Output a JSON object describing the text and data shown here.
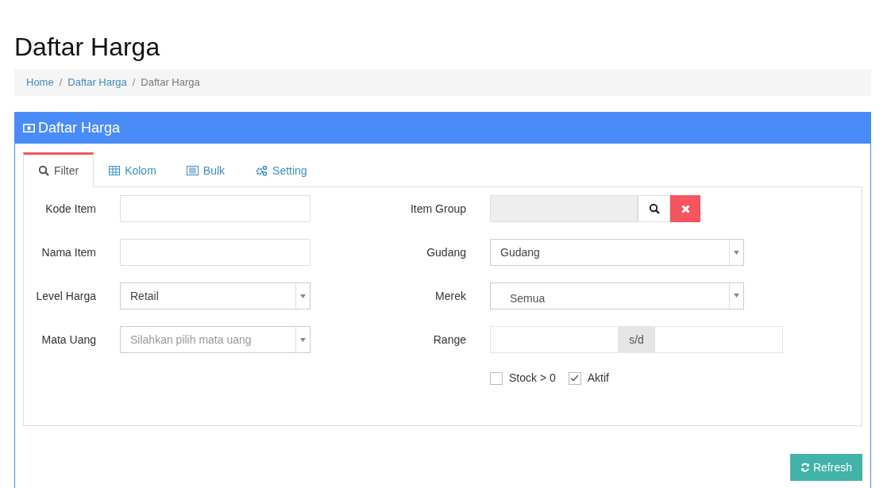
{
  "page_title": "Daftar Harga",
  "breadcrumb": {
    "separator": "/",
    "items": [
      {
        "label": "Home",
        "active": false
      },
      {
        "label": "Daftar Harga",
        "active": false
      },
      {
        "label": "Daftar Harga",
        "active": true
      }
    ]
  },
  "panel": {
    "title": "Daftar Harga",
    "tabs": [
      {
        "label": "Filter",
        "kind": "search",
        "selected": true
      },
      {
        "label": "Kolom",
        "kind": "table",
        "selected": false
      },
      {
        "label": "Bulk",
        "kind": "list",
        "selected": false
      },
      {
        "label": "Setting",
        "kind": "gears",
        "selected": false
      }
    ],
    "filters_left": [
      {
        "label": "Kode Item",
        "kind": "text"
      },
      {
        "label": "Nama Item",
        "kind": "text"
      },
      {
        "label": "Level Harga",
        "kind": "select",
        "value": "Retail"
      },
      {
        "label": "Mata Uang",
        "kind": "select",
        "placeholder": "Silahkan pilih mata uang"
      }
    ],
    "filters_right": [
      {
        "label": "Item Group",
        "kind": "lookup"
      },
      {
        "label": "Gudang",
        "kind": "select",
        "value": "Gudang"
      },
      {
        "label": "Merek",
        "kind": "multiselect",
        "value": "Semua"
      },
      {
        "label": "Range",
        "kind": "range",
        "separator": "s/d"
      }
    ],
    "checkboxes": [
      {
        "label": "Stock > 0",
        "checked": false
      },
      {
        "label": "Aktif",
        "checked": true
      }
    ],
    "refresh_button": "Refresh"
  }
}
